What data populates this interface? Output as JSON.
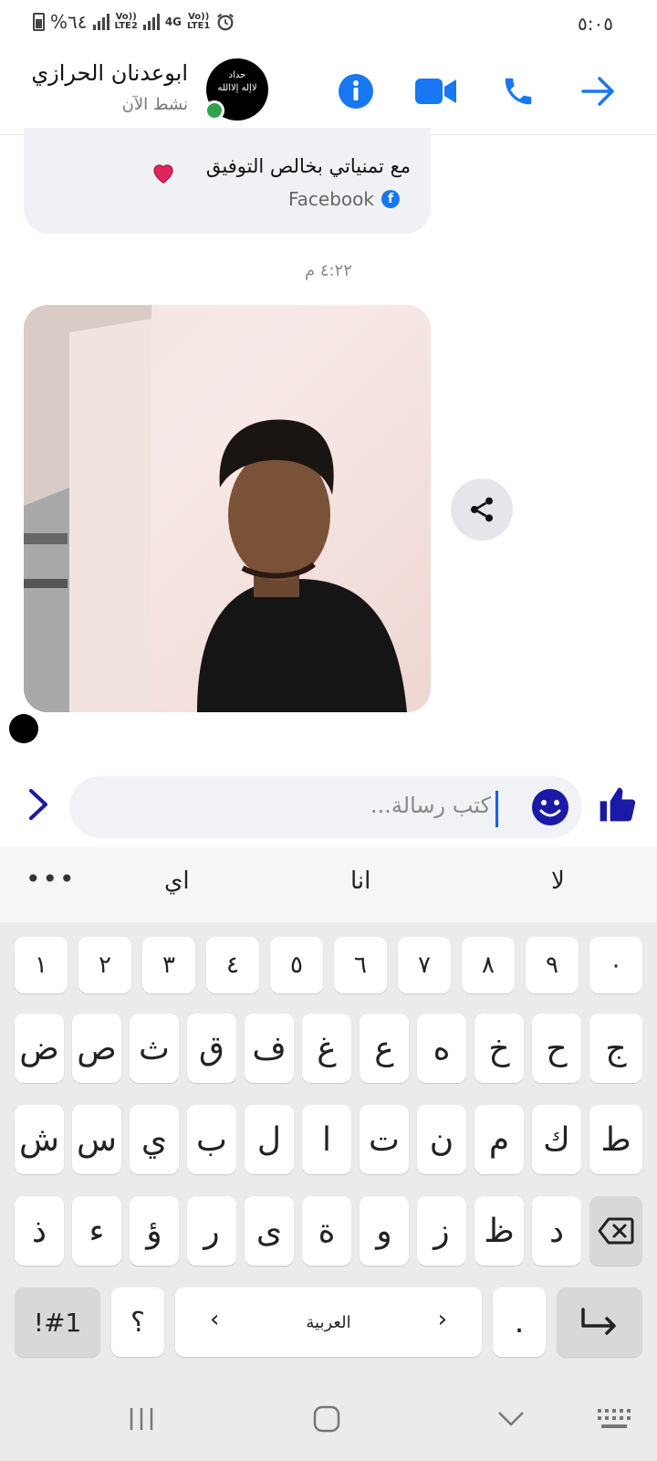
{
  "status_bar": {
    "battery": "%٦٤",
    "network_1": "Vo))\nLTE2",
    "network_2": "4G",
    "network_3": "Vo))\nLTE1",
    "time": "٥:٠٥"
  },
  "header": {
    "contact_name": "ابوعدنان الحرازي",
    "status": "نشط الآن",
    "avatar_text": "حداد\nلاإله إلاالله",
    "icons": [
      "info-icon",
      "video-call-icon",
      "phone-call-icon",
      "forward-arrow-icon"
    ]
  },
  "chat": {
    "message_text": "مع تمنياتي بخالص التوفيق",
    "source_label": "Facebook",
    "timestamp": "٤:٢٢ م",
    "share_icon": "share-icon"
  },
  "composer": {
    "placeholder": "كتب رسالة...",
    "icons": [
      "chevron-right-icon",
      "emoji-icon",
      "like-icon"
    ]
  },
  "keyboard": {
    "suggestions": [
      "لا",
      "انا",
      "اي"
    ],
    "more": "•••",
    "numbers": [
      "١",
      "٢",
      "٣",
      "٤",
      "٥",
      "٦",
      "٧",
      "٨",
      "٩",
      "٠"
    ],
    "row1": [
      "ض",
      "ص",
      "ث",
      "ق",
      "ف",
      "غ",
      "ع",
      "ه",
      "خ",
      "ح",
      "ج"
    ],
    "row2": [
      "ش",
      "س",
      "ي",
      "ب",
      "ل",
      "ا",
      "ت",
      "ن",
      "م",
      "ك",
      "ط"
    ],
    "row3": [
      "ذ",
      "ء",
      "ؤ",
      "ر",
      "ى",
      "ة",
      "و",
      "ز",
      "ظ",
      "د"
    ],
    "symbols_label": "!#1",
    "question": "؟",
    "space_label": "العربية",
    "period": "."
  },
  "colors": {
    "accent": "#1877f2",
    "dark_blue": "#1a1aa6",
    "online": "#31a24c"
  }
}
